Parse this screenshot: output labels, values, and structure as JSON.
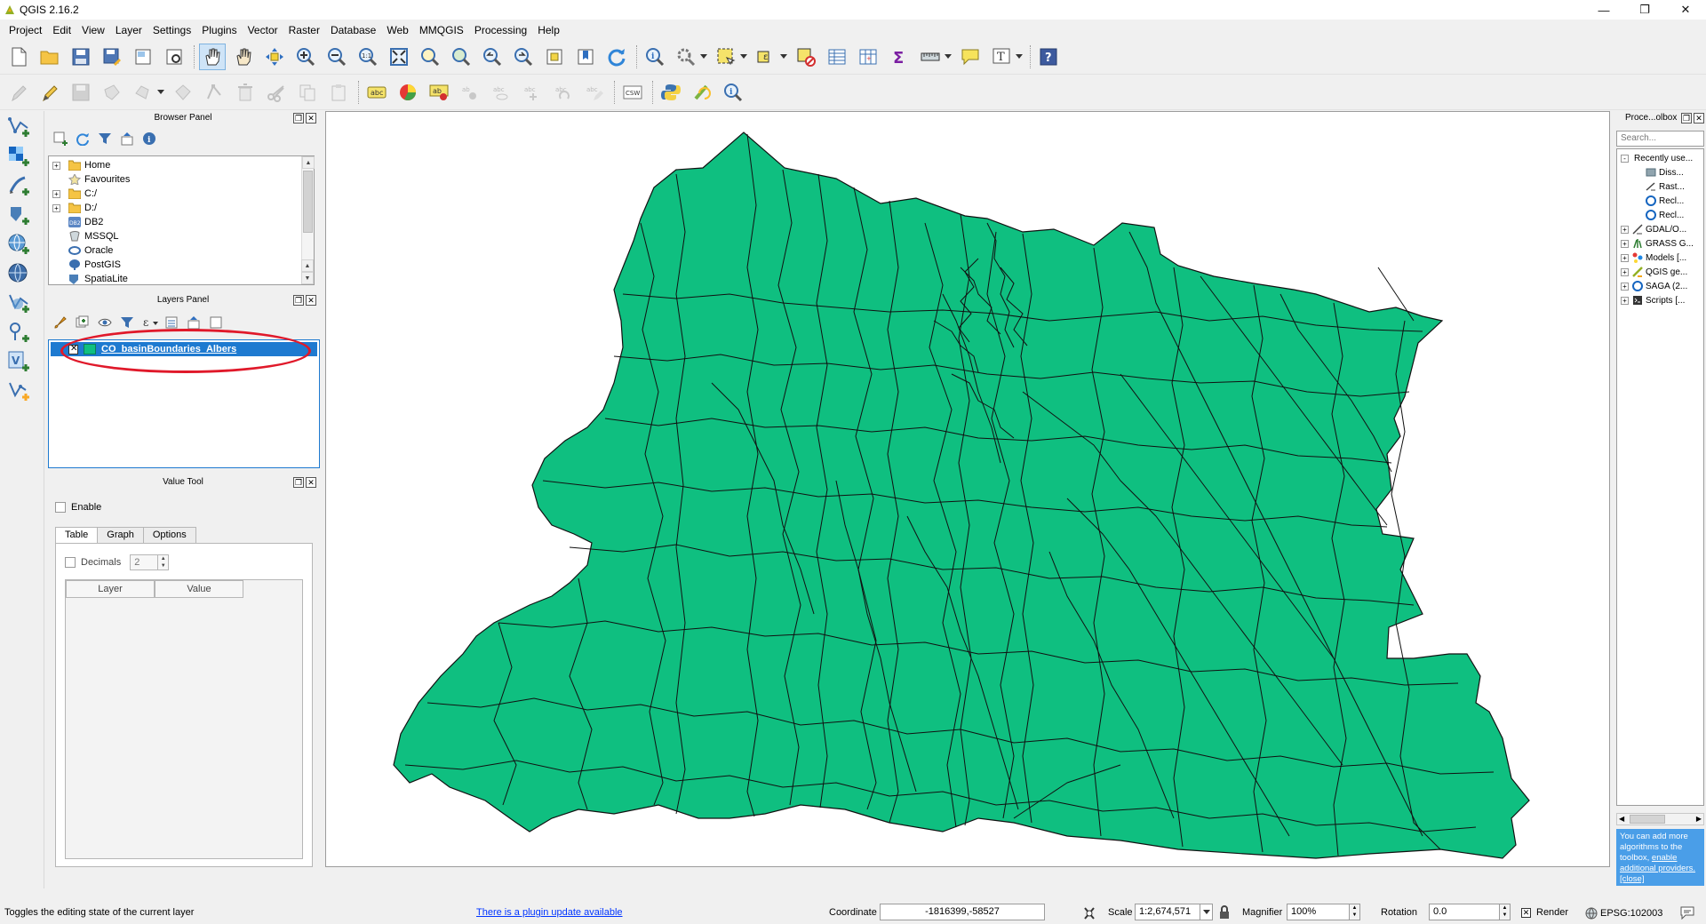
{
  "window": {
    "title": "QGIS 2.16.2",
    "controls": [
      "minimize",
      "restore",
      "close"
    ]
  },
  "menubar": {
    "items": [
      "Project",
      "Edit",
      "View",
      "Layer",
      "Settings",
      "Plugins",
      "Vector",
      "Raster",
      "Database",
      "Web",
      "MMQGIS",
      "Processing",
      "Help"
    ]
  },
  "browser_panel": {
    "title": "Browser Panel",
    "items": [
      {
        "label": "Home",
        "icon": "folder-icon",
        "expandable": true
      },
      {
        "label": "Favourites",
        "icon": "star-icon",
        "expandable": false
      },
      {
        "label": "C:/",
        "icon": "folder-icon",
        "expandable": true
      },
      {
        "label": "D:/",
        "icon": "folder-icon",
        "expandable": true
      },
      {
        "label": "DB2",
        "icon": "db2-icon",
        "expandable": false
      },
      {
        "label": "MSSQL",
        "icon": "mssql-icon",
        "expandable": false
      },
      {
        "label": "Oracle",
        "icon": "oracle-icon",
        "expandable": false
      },
      {
        "label": "PostGIS",
        "icon": "postgis-icon",
        "expandable": false
      },
      {
        "label": "SpatiaLite",
        "icon": "spatialite-icon",
        "expandable": false
      }
    ]
  },
  "layers_panel": {
    "title": "Layers Panel",
    "layers": [
      {
        "name": "CO_basinBoundaries_Albers",
        "visible": true,
        "selected": true,
        "fill_color": "#0fbf80"
      }
    ]
  },
  "value_tool": {
    "title": "Value Tool",
    "enable_label": "Enable",
    "tabs": [
      "Table",
      "Graph",
      "Options"
    ],
    "active_tab": "Table",
    "decimals_label": "Decimals",
    "decimals_value": "2",
    "columns": [
      "Layer",
      "Value"
    ]
  },
  "processing_toolbox": {
    "title": "Proce...olbox",
    "search_placeholder": "Search...",
    "items": [
      {
        "label": "Recently use...",
        "level": 0,
        "expander": "-"
      },
      {
        "label": "Diss...",
        "level": 1
      },
      {
        "label": "Rast...",
        "level": 1
      },
      {
        "label": "Recl...",
        "level": 1
      },
      {
        "label": "Recl...",
        "level": 1
      },
      {
        "label": "GDAL/O...",
        "level": 0,
        "expander": "+"
      },
      {
        "label": "GRASS G...",
        "level": 0,
        "expander": "+"
      },
      {
        "label": "Models [...",
        "level": 0,
        "expander": "+"
      },
      {
        "label": "QGIS ge...",
        "level": 0,
        "expander": "+"
      },
      {
        "label": "SAGA (2...",
        "level": 0,
        "expander": "+"
      },
      {
        "label": "Scripts [...",
        "level": 0,
        "expander": "+"
      }
    ],
    "note_text": "You can add more algorithms to the toolbox,",
    "note_link1": "enable additional providers.",
    "note_link2": "[close]"
  },
  "statusbar": {
    "message": "Toggles the editing state of the current layer",
    "plugin_update": "There is a plugin update available",
    "coordinate_label": "Coordinate",
    "coordinate_value": "-1816399,-58527",
    "scale_label": "Scale",
    "scale_value": "1:2,674,571",
    "magnifier_label": "Magnifier",
    "magnifier_value": "100%",
    "rotation_label": "Rotation",
    "rotation_value": "0.0",
    "render_label": "Render",
    "epsg_label": "EPSG:102003"
  },
  "colors": {
    "basin_fill": "#0fbf80",
    "selection": "#1e7ad0",
    "highlight_ellipse": "#e0192a",
    "toolbox_note_bg": "#4a9ee8"
  }
}
